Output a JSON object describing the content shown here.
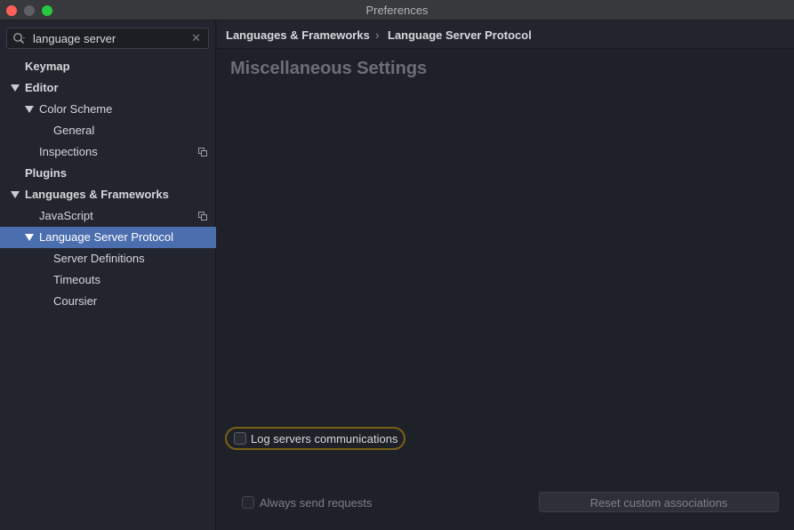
{
  "window": {
    "title": "Preferences"
  },
  "search": {
    "value": "language server"
  },
  "tree": [
    {
      "label": "Keymap"
    },
    {
      "label": "Editor"
    },
    {
      "label": "Color Scheme"
    },
    {
      "label": "General"
    },
    {
      "label": "Inspections"
    },
    {
      "label": "Plugins"
    },
    {
      "label": "Languages & Frameworks"
    },
    {
      "label": "JavaScript"
    },
    {
      "label": "Language Server Protocol"
    },
    {
      "label": "Server Definitions"
    },
    {
      "label": "Timeouts"
    },
    {
      "label": "Coursier"
    }
  ],
  "breadcrumb": {
    "parent": "Languages & Frameworks",
    "separator": "›",
    "current": "Language Server Protocol"
  },
  "content": {
    "section_title": "Miscellaneous Settings",
    "log_checkbox_label": "Log servers communications",
    "always_send_label": "Always send requests",
    "reset_button_label": "Reset custom associations"
  },
  "colors": {
    "selection": "#4b6eaf",
    "focus_ring": "#7a6017",
    "background": "#1f2128"
  }
}
